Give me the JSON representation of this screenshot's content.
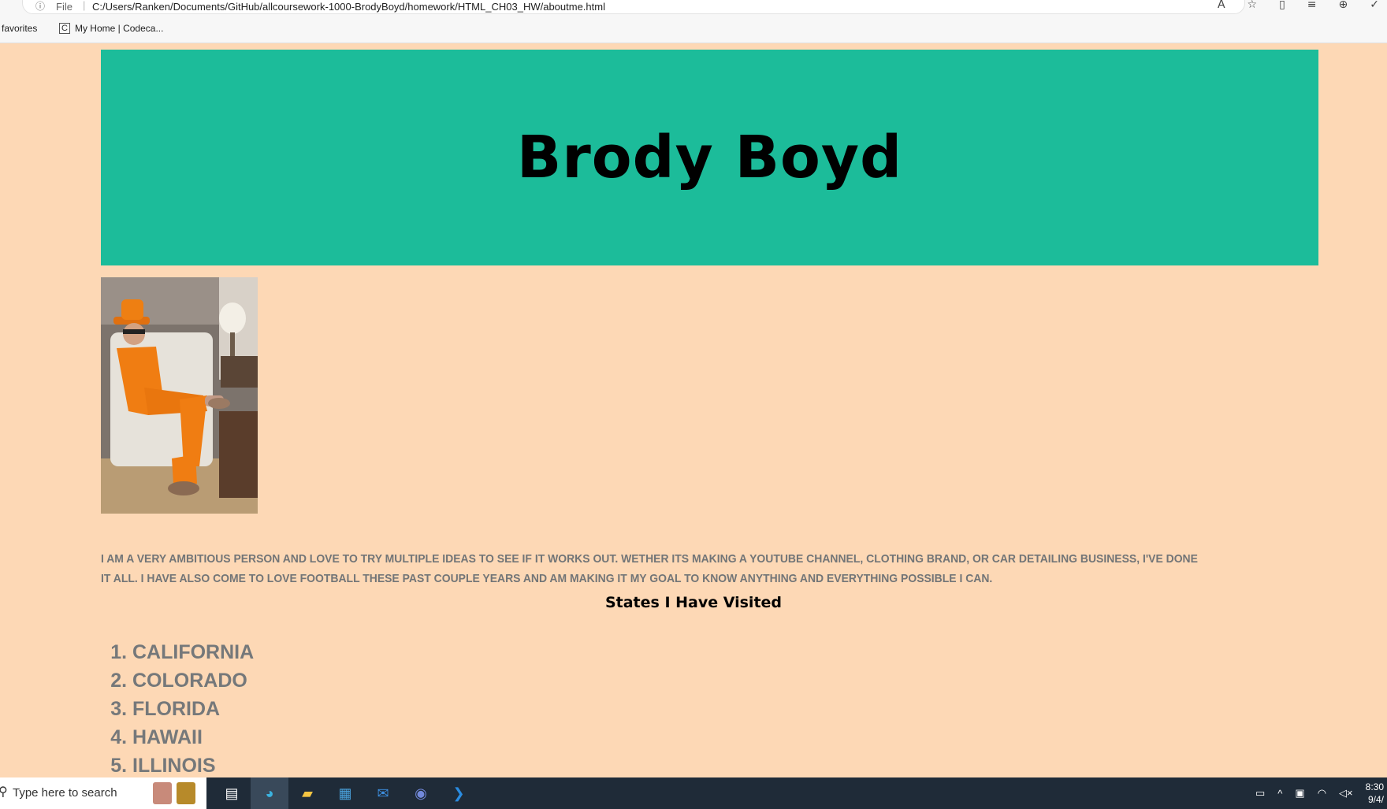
{
  "browser": {
    "info_icon": "info-circle-icon",
    "file_label": "File",
    "url": "C:/Users/Ranken/Documents/GitHub/allcoursework-1000-BrodyBoyd/homework/HTML_CH03_HW/aboutme.html",
    "favorites_label": "favorites",
    "bookmark_label": "My Home | Codeca..."
  },
  "page": {
    "name": "Brody Boyd",
    "bio": "I am a very ambitious person and love to try multiple ideas to see if it works out. Wether its making a youtube channel, clothing brand, or car detailing business, I've done it all. I have also come to love football these past couple years and am making it my goal to know anything and everything possible I can.",
    "states_heading": "States I Have Visited",
    "states": [
      "California",
      "Colorado",
      "Florida",
      "Hawaii",
      "Illinois"
    ]
  },
  "taskbar": {
    "search_placeholder": "Type here to search",
    "clock_time": "8:30",
    "clock_date": "9/4/"
  },
  "colors": {
    "page_background": "#fdd8b5",
    "banner": "#1cbc9a",
    "text_gray": "#727577"
  }
}
